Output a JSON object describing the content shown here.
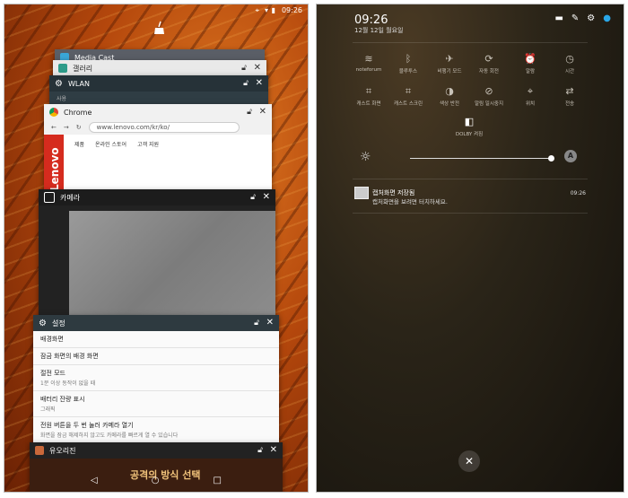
{
  "left": {
    "status_time": "09:26",
    "cards": {
      "media": "Media Cast",
      "gallery": "갤러리",
      "wlan": "WLAN",
      "wlan_sub": "사용",
      "chrome": "Chrome",
      "chrome_url": "www.lenovo.com/kr/ko/",
      "chrome_nav": [
        "제품",
        "온라인 스토어",
        "고객 지원"
      ],
      "brand": "Lenovo",
      "camera": "카메라",
      "settings": "설정",
      "settings_items": [
        {
          "title": "배경화면",
          "sub": ""
        },
        {
          "title": "잠금 화면의 배경 화면",
          "sub": ""
        },
        {
          "title": "절전 모드",
          "sub": "1분 이상 동작이 없을 때"
        },
        {
          "title": "배터리 잔량 표시",
          "sub": "그래픽"
        },
        {
          "title": "전원 버튼을 두 번 눌러 카메라 열기",
          "sub": "화면을 잠금 해제하지 않고도 카메라를 빠르게 열 수 있습니다"
        }
      ],
      "game": "유오리진",
      "game_banner": "공격의 방식 선택"
    }
  },
  "right": {
    "time": "09:26",
    "date": "12월 12일 월요일",
    "tiles_row1": [
      "noteforum",
      "블루투스",
      "비행기 모드",
      "자동 회전",
      "알람",
      "시간"
    ],
    "tiles_row2": [
      "캐스트 화면",
      "캐스트 스크린",
      "색상 반전",
      "알림 일시중지",
      "위치",
      "전송"
    ],
    "dolby": "DOLBY 켜짐",
    "notif_title": "캡처화면 저장됨",
    "notif_text": "캡처화면을 보려면 터치하세요.",
    "notif_time": "09:26"
  }
}
